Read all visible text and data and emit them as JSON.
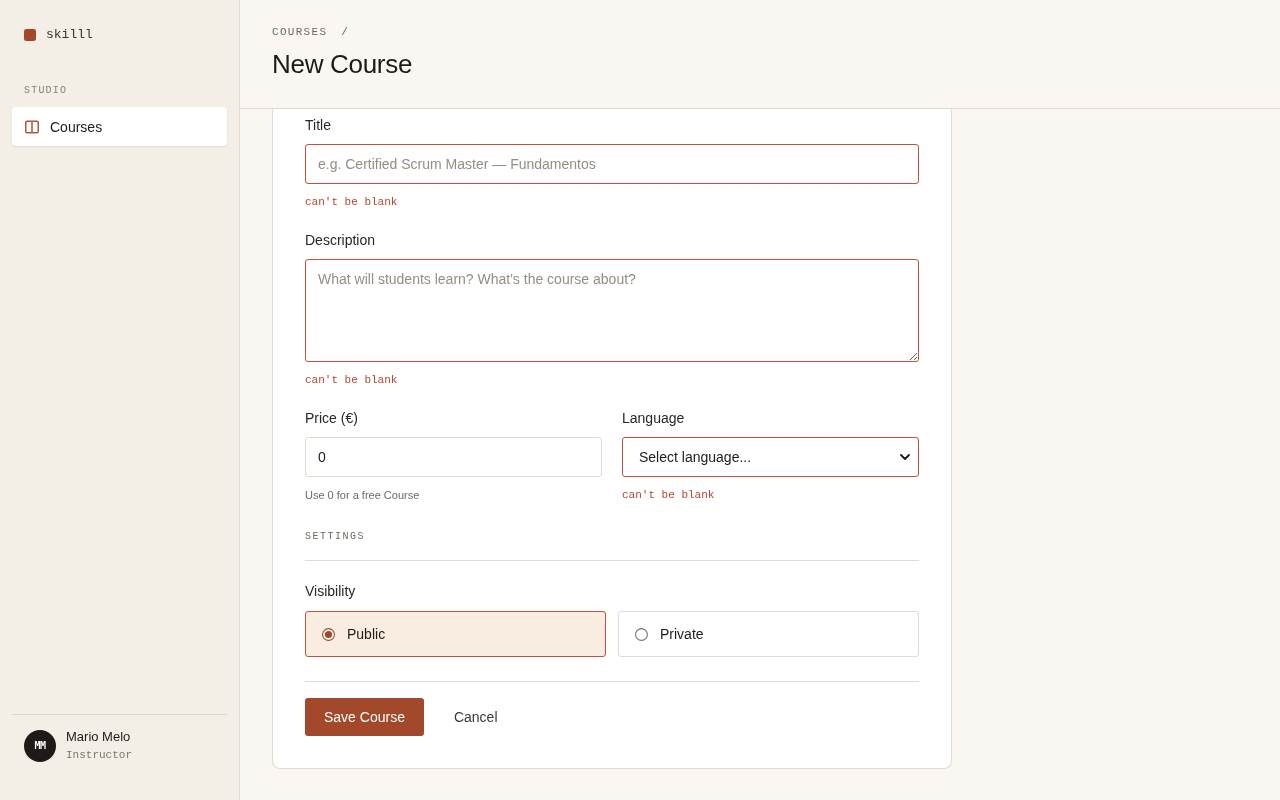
{
  "sidebar": {
    "brand": "skilll",
    "section_label": "STUDIO",
    "items": [
      {
        "label": "Courses",
        "selected": true
      }
    ],
    "user": {
      "initials": "MM",
      "name": "Mario Melo",
      "role": "Instructor"
    }
  },
  "header": {
    "breadcrumb": [
      {
        "label": "COURSES"
      }
    ],
    "separator": "/",
    "title": "New Course"
  },
  "form": {
    "fields": [
      {
        "kind": "text",
        "label": "Title",
        "placeholder": "e.g. Certified Scrum Master — Fundamentos",
        "error": "can't be blank"
      },
      {
        "kind": "textarea",
        "label": "Description",
        "placeholder": "What will students learn? What's the course about?",
        "error": "can't be blank"
      }
    ],
    "row_fields": [
      {
        "kind": "number",
        "label": "Price (€)",
        "value": "0",
        "hint": "Use 0 for a free Course"
      },
      {
        "kind": "select",
        "label": "Language",
        "value": "Select language...",
        "error": "can't be blank"
      }
    ],
    "settings": {
      "heading": "SETTINGS",
      "visibility": {
        "label": "Visibility",
        "options": [
          {
            "label": "Public",
            "selected": true
          },
          {
            "label": "Private",
            "selected": false
          }
        ]
      }
    },
    "actions": [
      {
        "kind": "primary",
        "label": "Save Course"
      },
      {
        "kind": "secondary",
        "label": "Cancel"
      }
    ]
  }
}
